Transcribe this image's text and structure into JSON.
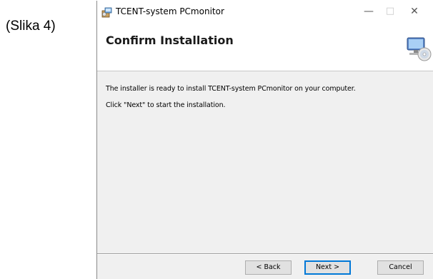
{
  "caption": "(Slika 4)",
  "window": {
    "title": "TCENT-system PCmonitor",
    "controls": {
      "minimize": "—",
      "maximize": "□",
      "close": "✕"
    },
    "icons": {
      "app": "installer-app-icon",
      "header": "computer-cd-icon"
    }
  },
  "header": {
    "title": "Confirm Installation"
  },
  "body": {
    "line1": "The installer is ready to install TCENT-system PCmonitor on your computer.",
    "line2": "Click \"Next\" to start the installation."
  },
  "buttons": {
    "back": "< Back",
    "next": "Next >",
    "cancel": "Cancel"
  },
  "colors": {
    "default_button_border": "#0078d7",
    "window_bg": "#f0f0f0"
  }
}
